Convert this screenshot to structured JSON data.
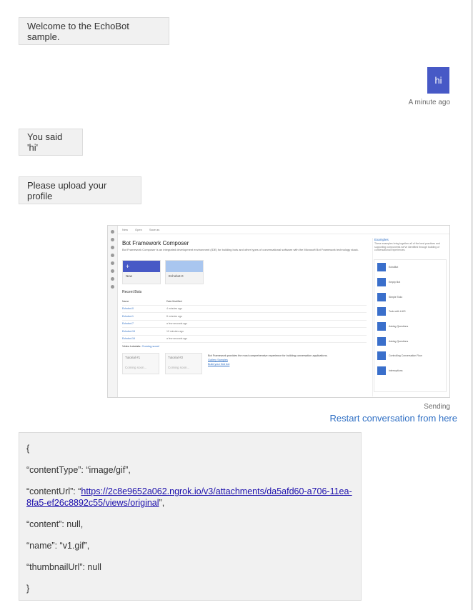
{
  "messages": {
    "welcome": "Welcome to the EchoBot sample.",
    "user_hi": "hi",
    "user_hi_time": "A minute ago",
    "you_said": "You said 'hi'",
    "upload_prompt": "Please upload your profile",
    "sending": "Sending",
    "restart": "Restart conversation from here"
  },
  "attachment_json": {
    "open": "{",
    "content_type_line": "“contentType”: “image/gif”,",
    "content_url_key": "“contentUrl”: “",
    "content_url_value": "https://2c8e9652a062.ngrok.io/v3/attachments/da5afd60-a706-11ea-8fa5-ef26c8892c55/views/original",
    "content_url_end": "”,",
    "content_line": "“content”: null,",
    "name_line": "“name”: “v1.gif”,",
    "thumbnail_line": "“thumbnailUrl”: null",
    "close": "}"
  },
  "uploaded_image": {
    "toolbar": [
      "New",
      "Open",
      "Save as"
    ],
    "title": "Bot Framework Composer",
    "description": "Bot Framework Composer is an integrated development environment (IDE) for building bots and other types of conversational software with the Microsoft Bot Framework technology stack.",
    "cards": [
      "New",
      "Echobot-0"
    ],
    "recent_title": "Recent Bots",
    "recent_headers": [
      "Name",
      "Date Modified"
    ],
    "recent_rows": [
      [
        "Echobot-0",
        "4 minutes ago"
      ],
      [
        "Echobot-1",
        "8 minutes ago"
      ],
      [
        "Echobot-7",
        "a few seconds ago"
      ],
      [
        "Echobot-15",
        "10 minutes ago"
      ],
      [
        "Echobot-16",
        "a few seconds ago"
      ]
    ],
    "video_label": "Video tutorials:",
    "video_link": "Coming soon!",
    "tutorials": [
      {
        "name": "Tutorial #1",
        "note": "Coming soon..."
      },
      {
        "name": "Tutorial #2",
        "note": "Coming soon..."
      }
    ],
    "bf_text": "Bot Framework provides the most comprehensive experience for building conversation applications.",
    "bf_links": [
      "Gallery Samples",
      "Build your first bot"
    ],
    "examples_title": "Examples",
    "examples_desc": "These examples bring together all of the best practices and supporting components we've identified through building of conversational experiences.",
    "examples": [
      "EchoBot",
      "Empty Bot",
      "Simple Todo",
      "Todo with LUIS",
      "Asking Questions",
      "Asking Questions",
      "Controlling Conversation Flow",
      "Interruptions"
    ]
  }
}
